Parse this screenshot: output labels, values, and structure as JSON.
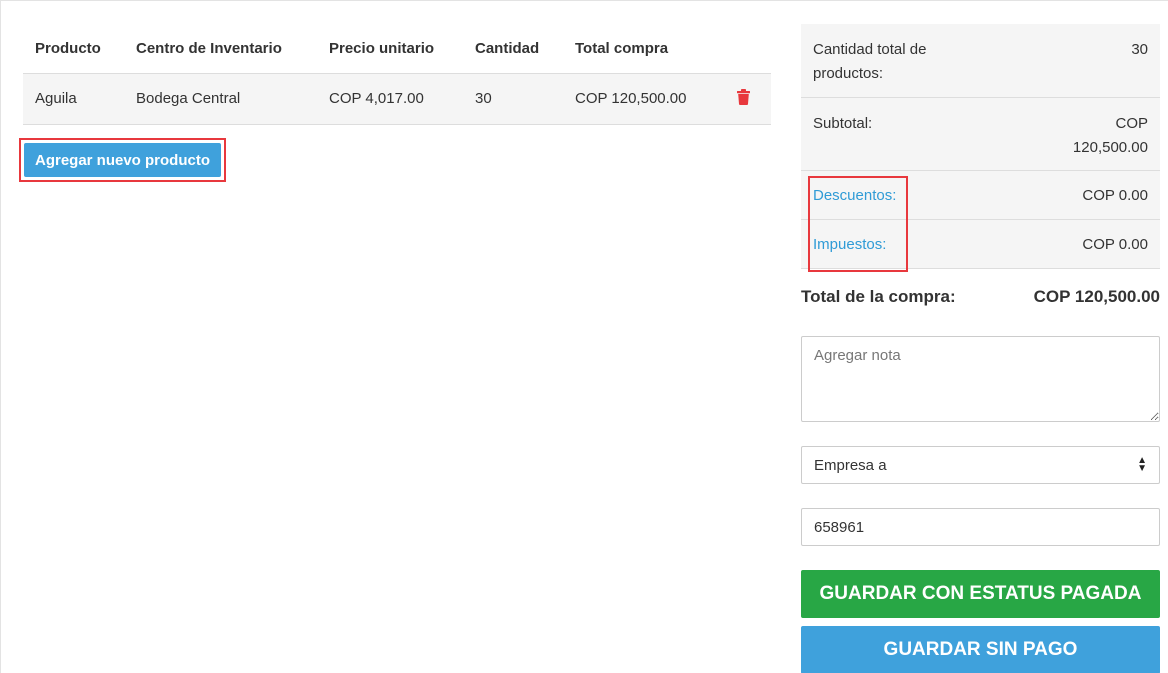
{
  "table": {
    "headers": {
      "producto": "Producto",
      "centro": "Centro de Inventario",
      "precio": "Precio unitario",
      "cantidad": "Cantidad",
      "total": "Total compra"
    },
    "rows": [
      {
        "producto": "Aguila",
        "centro": "Bodega Central",
        "precio": "COP 4,017.00",
        "cantidad": "30",
        "total": "COP 120,500.00",
        "delete_icon": "trash-icon"
      }
    ]
  },
  "add_product_label": "Agregar nuevo producto",
  "summary": {
    "qty_label": "Cantidad total de productos:",
    "qty_value": "30",
    "subtotal_label": "Subtotal:",
    "subtotal_value": "COP 120,500.00",
    "discounts_label": "Descuentos:",
    "discounts_value": "COP 0.00",
    "taxes_label": "Impuestos:",
    "taxes_value": "COP 0.00",
    "total_label": "Total de la compra:",
    "total_value": "COP 120,500.00"
  },
  "note": {
    "placeholder": "Agregar nota"
  },
  "company_select": {
    "selected": "Empresa a",
    "icon": "select-arrows-icon"
  },
  "number_field": {
    "value": "658961"
  },
  "buttons": {
    "save_paid": "GUARDAR CON ESTATUS PAGADA",
    "save_unpaid": "GUARDAR SIN PAGO"
  },
  "colors": {
    "primary_blue": "#3fa1dc",
    "success_green": "#28a745",
    "danger_red": "#e8383d",
    "link_blue": "#2f9bd6"
  }
}
